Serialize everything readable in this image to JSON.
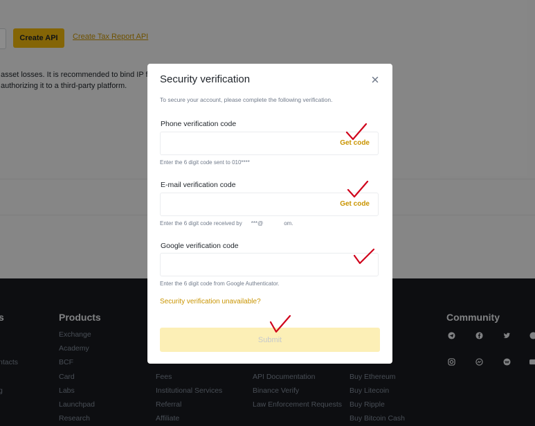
{
  "background": {
    "create_api_label": "Create API",
    "tax_report_link": "Create Tax Report API",
    "warning_line1": "asset losses. It is recommended to bind IP for A",
    "warning_line2": "authorizing it to a third-party platform."
  },
  "footer": {
    "partial_heading": "s",
    "partial_links": [
      "ntacts",
      "g"
    ],
    "products_heading": "Products",
    "products": [
      "Exchange",
      "Academy",
      "BCF",
      "Card",
      "Labs",
      "Launchpad",
      "Research"
    ],
    "col3": [
      "Fees",
      "Institutional Services",
      "Referral",
      "Affiliate"
    ],
    "col4": [
      "API Documentation",
      "Binance Verify",
      "Law Enforcement Requests"
    ],
    "col5": [
      "Buy Ethereum",
      "Buy Litecoin",
      "Buy Ripple",
      "Buy Bitcoin Cash"
    ],
    "community_heading": "Community"
  },
  "modal": {
    "title": "Security verification",
    "description": "To secure your account, please complete the following verification.",
    "phone": {
      "label": "Phone verification code",
      "value": "",
      "action": "Get code",
      "hint": "Enter the 6 digit code sent to 010****"
    },
    "email": {
      "label": "E-mail verification code",
      "value": "",
      "action": "Get code",
      "hint_prefix": "Enter the 6 digit code received by",
      "hint_mask": "***@",
      "hint_suffix": "om."
    },
    "google": {
      "label": "Google verification code",
      "value": "",
      "hint": "Enter the 6 digit code from Google Authenticator."
    },
    "unavailable_link": "Security verification unavailable?",
    "submit_label": "Submit"
  },
  "colors": {
    "accent": "#f0b90b",
    "link": "#c99400",
    "check_mark": "#d0021b",
    "footer_bg": "#181a20",
    "submit_disabled_bg": "#fcefb6"
  },
  "icons": {
    "close": "close-icon",
    "check": "red-check-mark-icon",
    "social": [
      "telegram-icon",
      "facebook-icon",
      "twitter-icon",
      "reddit-icon",
      "instagram-icon",
      "coinmarketcap-icon",
      "vk-icon",
      "youtube-icon"
    ]
  }
}
